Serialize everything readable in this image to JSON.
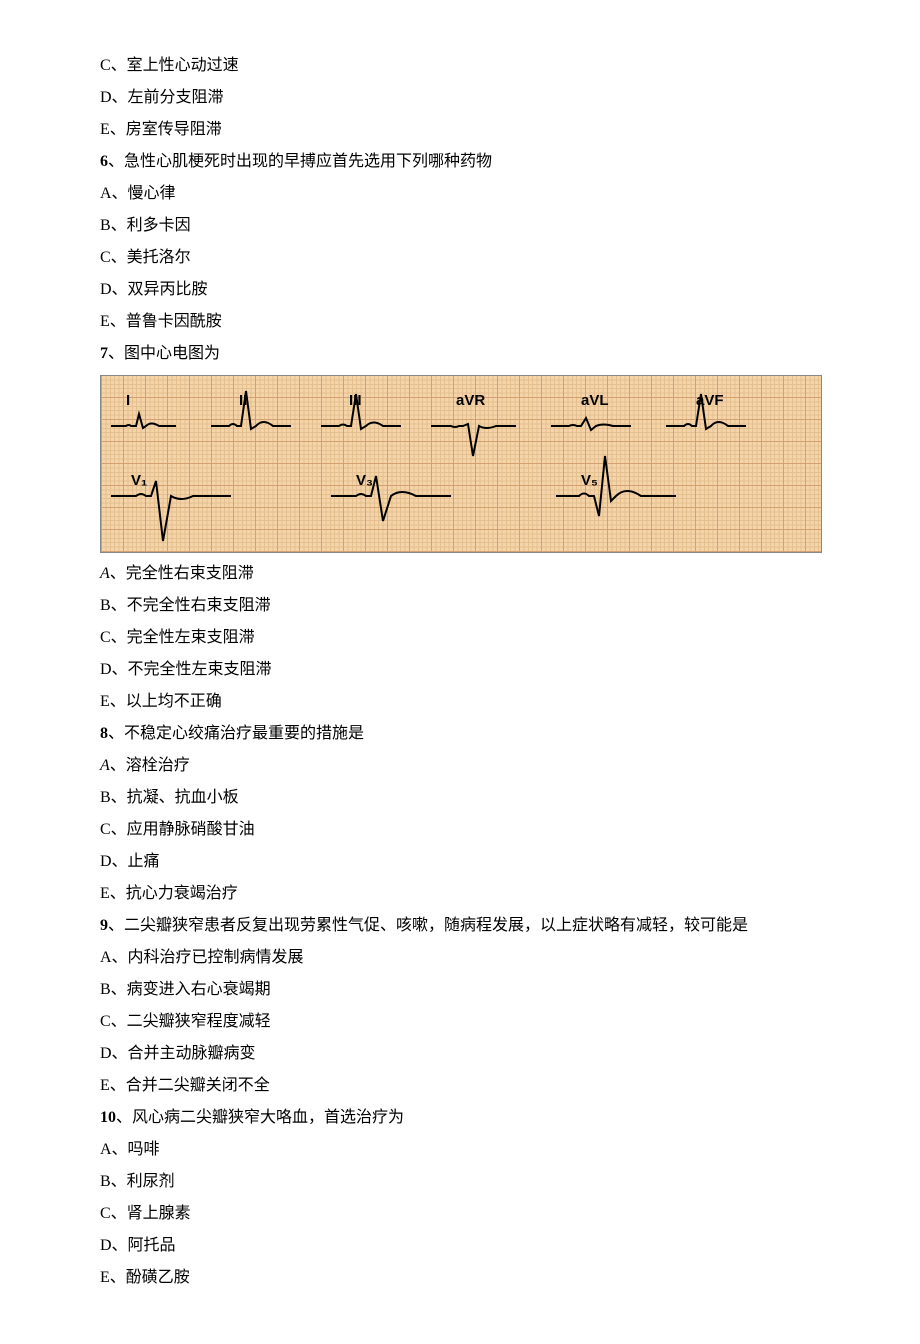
{
  "q5_continued": {
    "optC": "C、室上性心动过速",
    "optD": "D、左前分支阻滞",
    "optE": "E、房室传导阻滞"
  },
  "q6": {
    "stem_num": "6",
    "stem_text": "、急性心肌梗死时出现的早搏应首先选用下列哪种药物",
    "optA": "A、慢心律",
    "optB": "B、利多卡因",
    "optC": "C、美托洛尔",
    "optD": "D、双异丙比胺",
    "optE": "E、普鲁卡因酰胺"
  },
  "q7": {
    "stem_num": "7",
    "stem_text": "、图中心电图为",
    "ecg_leads": {
      "I": "I",
      "II": "II",
      "III": "III",
      "aVR": "aVR",
      "aVL": "aVL",
      "aVF": "aVF",
      "V1": "V₁",
      "V3": "V₃",
      "V5": "V₅"
    },
    "optA_letter": "A",
    "optA_text": "、完全性右束支阻滞",
    "optB": "B、不完全性右束支阻滞",
    "optC": "C、完全性左束支阻滞",
    "optD": "D、不完全性左束支阻滞",
    "optE": "E、以上均不正确"
  },
  "q8": {
    "stem_num": "8",
    "stem_text": "、不稳定心绞痛治疗最重要的措施是",
    "optA_letter": "A",
    "optA_text": "、溶栓治疗",
    "optB": "B、抗凝、抗血小板",
    "optC": "C、应用静脉硝酸甘油",
    "optD": "D、止痛",
    "optE": "E、抗心力衰竭治疗"
  },
  "q9": {
    "stem_num": "9",
    "stem_text": "、二尖瓣狭窄患者反复出现劳累性气促、咳嗽，随病程发展，以上症状略有减轻，较可能是",
    "optA": "A、内科治疗已控制病情发展",
    "optB": "B、病变进入右心衰竭期",
    "optC": "C、二尖瓣狭窄程度减轻",
    "optD": "D、合并主动脉瓣病变",
    "optE": "E、合并二尖瓣关闭不全"
  },
  "q10": {
    "stem_num": "10",
    "stem_text": "、风心病二尖瓣狭窄大咯血，首选治疗为",
    "optA": "A、吗啡",
    "optB": "B、利尿剂",
    "optC": "C、肾上腺素",
    "optD": "D、阿托品",
    "optE": "E、酚磺乙胺"
  }
}
